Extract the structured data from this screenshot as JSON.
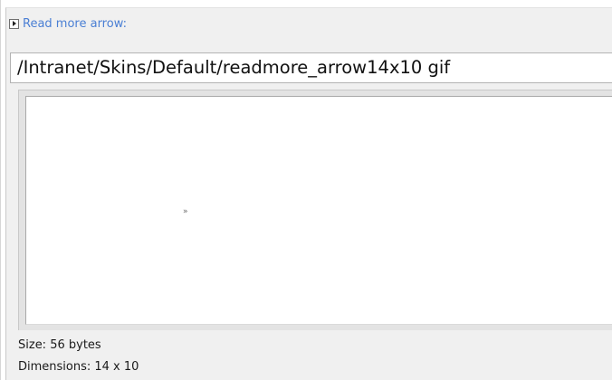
{
  "field": {
    "label": "Read more arrow:",
    "expand_icon": "expand-triangle-icon",
    "path_value": "/Intranet/Skins/Default/readmore_arrow14x10 gif"
  },
  "preview": {
    "image_glyph": "»",
    "image_icon": "double-arrow-icon"
  },
  "info": {
    "size_text": "Size: 56 bytes",
    "dimensions_text": "Dimensions: 14 x 10"
  },
  "colors": {
    "label_link": "#4a7fd4",
    "panel_bg": "#f0f0f0",
    "preview_bg": "#ffffff"
  }
}
